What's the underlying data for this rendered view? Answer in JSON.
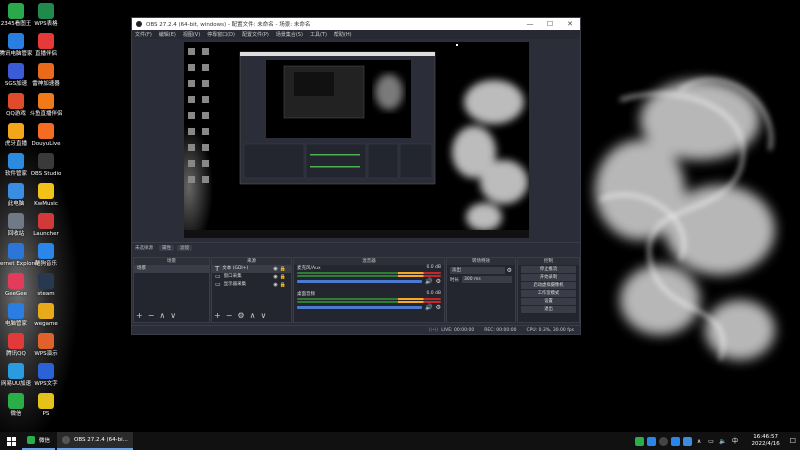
{
  "desktop": {
    "icons": [
      {
        "label": "2345看图王",
        "color": "#2aa84a"
      },
      {
        "label": "WPS表格",
        "color": "#1f8a4c"
      },
      {
        "label": "腾讯电脑管家",
        "color": "#2a7de1"
      },
      {
        "label": "直播伴侣",
        "color": "#e63a3a"
      },
      {
        "label": "SGS加速",
        "color": "#3c5bd6"
      },
      {
        "label": "雷神加速器",
        "color": "#e96a1a"
      },
      {
        "label": "QQ游戏",
        "color": "#e04b2b"
      },
      {
        "label": "斗鱼直播伴侣",
        "color": "#f07a1a"
      },
      {
        "label": "虎牙直播",
        "color": "#f2a71b"
      },
      {
        "label": "DouyuLive",
        "color": "#f36c21"
      },
      {
        "label": "软件管家",
        "color": "#2b8bde"
      },
      {
        "label": "OBS Studio",
        "color": "#3a3a3a"
      },
      {
        "label": "此电脑",
        "color": "#3a8de0"
      },
      {
        "label": "KwMusic",
        "color": "#f2c21b"
      },
      {
        "label": "回收站",
        "color": "#6f7a86"
      },
      {
        "label": "Launcher",
        "color": "#d03a3a"
      },
      {
        "label": "Internet Explorer",
        "color": "#2b76d6"
      },
      {
        "label": "酷狗音乐",
        "color": "#2a86e8"
      },
      {
        "label": "GeeGee",
        "color": "#e23b5b"
      },
      {
        "label": "steam",
        "color": "#27384f"
      },
      {
        "label": "电脑管家",
        "color": "#2a7de1"
      },
      {
        "label": "wegame",
        "color": "#e8a91a"
      },
      {
        "label": "腾讯QQ",
        "color": "#e23a3a"
      },
      {
        "label": "WPS演示",
        "color": "#e0612b"
      },
      {
        "label": "网易UU加速",
        "color": "#2a9be0"
      },
      {
        "label": "WPS文字",
        "color": "#2b62d6"
      },
      {
        "label": "微信",
        "color": "#2aae4a"
      },
      {
        "label": "PS",
        "color": "#e2c21b"
      }
    ]
  },
  "obs": {
    "title": "OBS 27.2.4 (64-bit, windows) - 配置文件: 未命名 - 场景: 未命名",
    "window_controls": [
      "—",
      "☐",
      "✕"
    ],
    "menu": [
      "文件(F)",
      "编辑(E)",
      "视图(V)",
      "停靠窗口(D)",
      "配置文件(P)",
      "场景集合(S)",
      "工具(T)",
      "帮助(H)"
    ],
    "source_bar": {
      "label": "未选择源",
      "properties": "属性",
      "filters": "滤镜"
    },
    "docks": {
      "scenes": {
        "title": "场景",
        "items": [
          "场景"
        ]
      },
      "sources": {
        "title": "来源",
        "items": [
          "文本 (GDI+)",
          "窗口采集",
          "显示器采集"
        ]
      },
      "mixer": {
        "title": "混音器",
        "channels": [
          {
            "name": "麦克风/Aux",
            "db": "0.0 dB"
          },
          {
            "name": "桌面音频",
            "db": "0.0 dB"
          }
        ]
      },
      "transitions": {
        "title": "转场特效",
        "type": "淡出",
        "duration_label": "时长",
        "duration": "300 ms"
      },
      "controls": {
        "title": "控制",
        "buttons": [
          "停止推流",
          "开始录制",
          "启动虚拟摄像机",
          "工作室模式",
          "设置",
          "退出"
        ]
      }
    },
    "status": {
      "live": "LIVE: 00:00:00",
      "rec": "REC: 00:00:00",
      "cpu": "CPU: 0.3%, 30.00 fps"
    }
  },
  "taskbar": {
    "tasks": [
      {
        "label": "微信",
        "color": "#2aae4a"
      },
      {
        "label": "OBS 27.2.4 (64-bi...",
        "color": "#555"
      }
    ],
    "clock": {
      "time": "16:46:57",
      "date": "2022/4/16"
    },
    "tray_lang": "中"
  }
}
